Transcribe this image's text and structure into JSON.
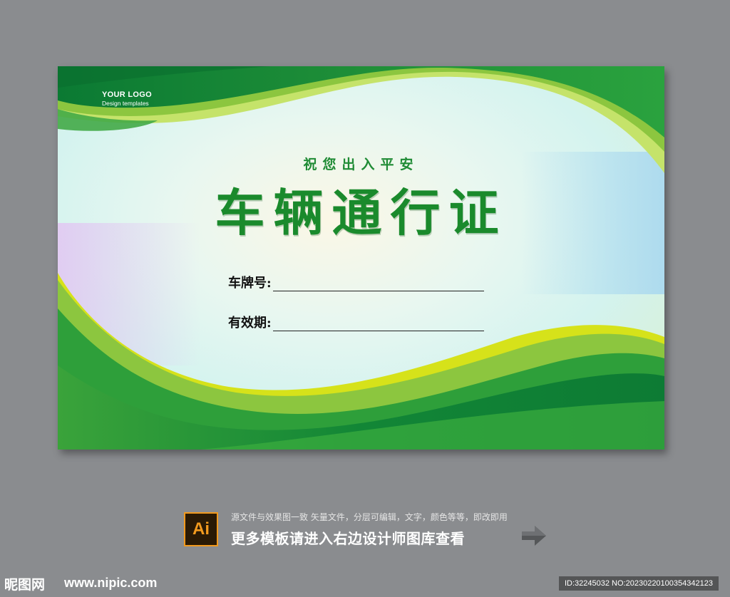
{
  "card": {
    "logo_title": "YOUR LOGO",
    "logo_subtitle": "Design templates",
    "subtitle": "祝您出入平安",
    "title": "车辆通行证",
    "fields": [
      {
        "label": "车牌号:"
      },
      {
        "label": "有效期:"
      }
    ]
  },
  "info": {
    "icon_label": "Ai",
    "small_text": "源文件与效果图一致 矢量文件，分层可编辑，文字，颜色等等，即改即用",
    "big_text": "更多模板请进入右边设计师图库查看"
  },
  "footer": {
    "site_name": "昵图网",
    "url": "www.nipic.com",
    "id_text": "ID:32245032 NO:20230220100354342123"
  },
  "colors": {
    "green_dark": "#0f7a35",
    "green_main": "#2e9f3a",
    "green_light": "#8cc63f",
    "yellow_green": "#d6e21a",
    "background": "#8a8c8f"
  }
}
